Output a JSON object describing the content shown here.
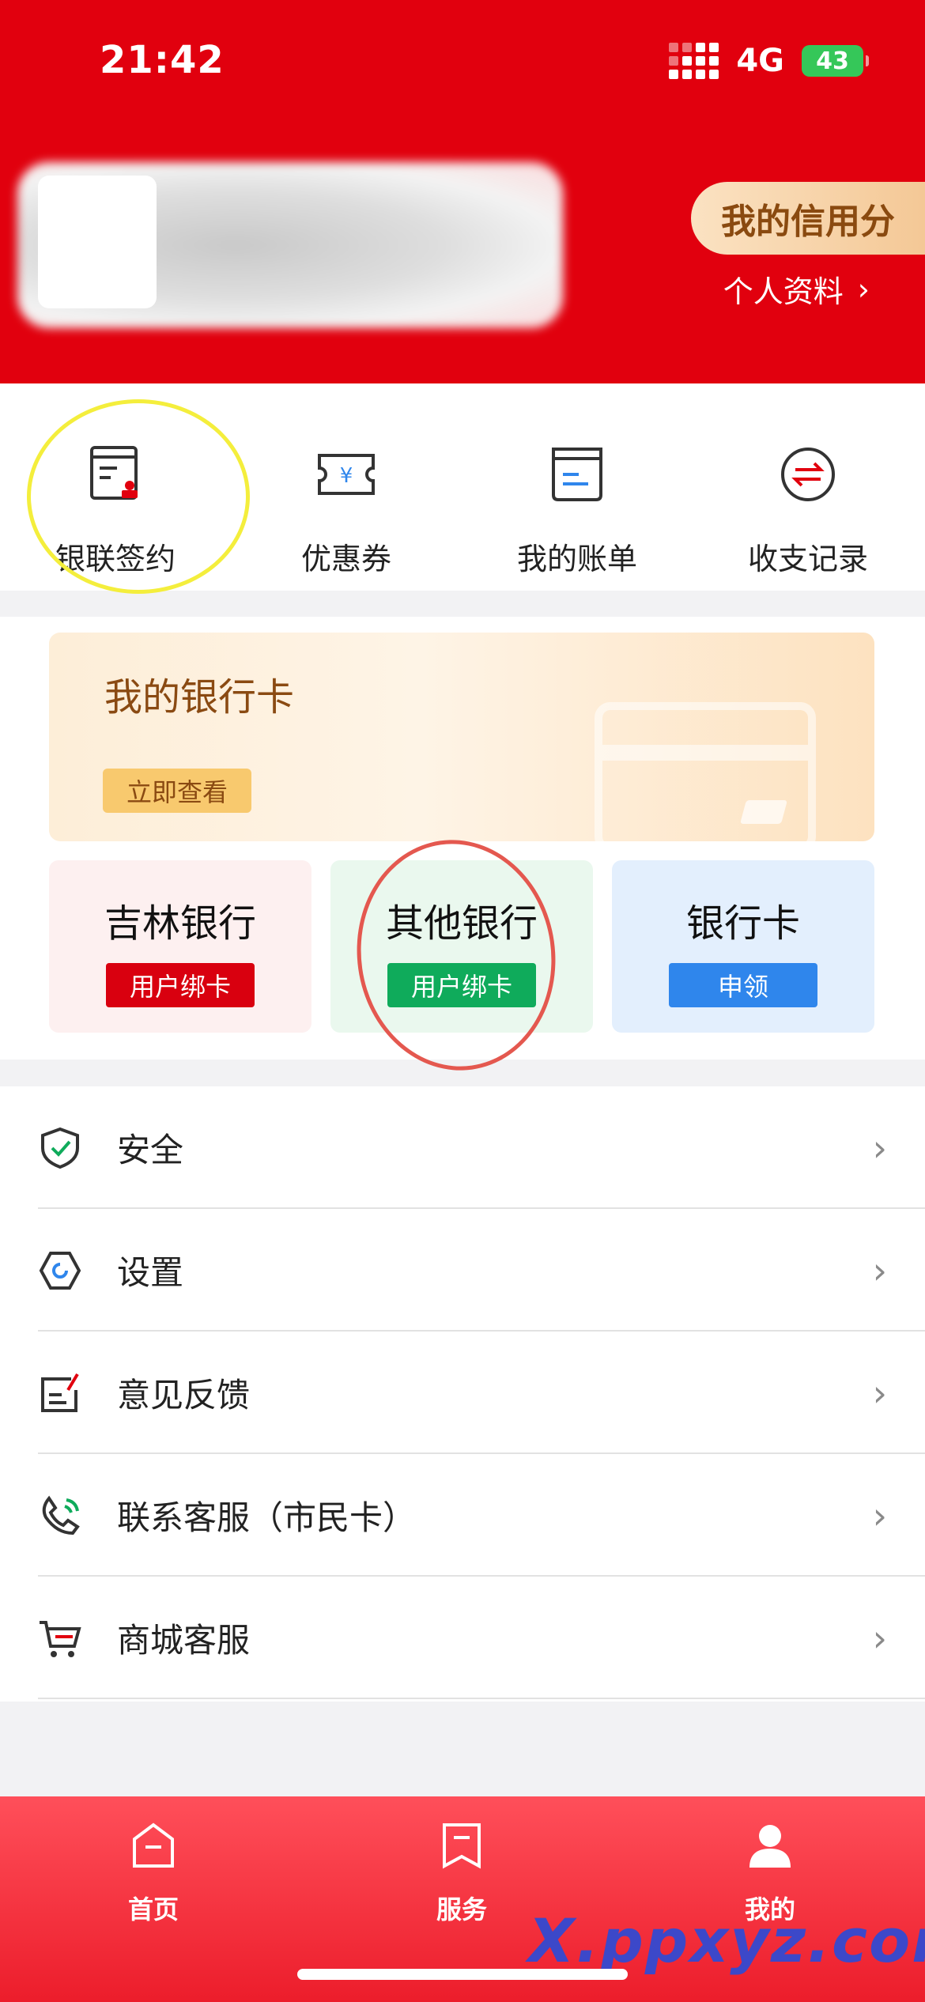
{
  "status_bar": {
    "time": "21:42",
    "network": "4G",
    "battery": "43"
  },
  "header": {
    "credit_label": "我的信用分",
    "profile_link": "个人资料",
    "profile_chevron": "›"
  },
  "quick_actions": [
    {
      "label": "银联签约",
      "icon": "contract-stamp-icon"
    },
    {
      "label": "优惠券",
      "icon": "coupon-ticket-icon"
    },
    {
      "label": "我的账单",
      "icon": "bill-icon"
    },
    {
      "label": "收支记录",
      "icon": "transfer-arrows-icon"
    }
  ],
  "bank_card": {
    "title": "我的银行卡",
    "view_button": "立即查看"
  },
  "bank_tiles": [
    {
      "name": "吉林银行",
      "button": "用户绑卡"
    },
    {
      "name": "其他银行",
      "button": "用户绑卡"
    },
    {
      "name": "银行卡",
      "button": "申领"
    }
  ],
  "menu": [
    {
      "label": "安全",
      "icon": "shield-check-icon"
    },
    {
      "label": "设置",
      "icon": "settings-hex-icon"
    },
    {
      "label": "意见反馈",
      "icon": "feedback-icon"
    },
    {
      "label": "联系客服（市民卡）",
      "icon": "phone-icon"
    },
    {
      "label": "商城客服",
      "icon": "cart-icon"
    }
  ],
  "menu_chevron": "›",
  "tabbar": [
    {
      "label": "首页",
      "icon": "home-icon"
    },
    {
      "label": "服务",
      "icon": "service-bookmark-icon"
    },
    {
      "label": "我的",
      "icon": "person-icon"
    }
  ],
  "watermark": "X.ppxyz.com",
  "colors": {
    "brand_red": "#e1000e",
    "green": "#0fab5b",
    "blue": "#2f86ec",
    "gold": "#f8c96e"
  }
}
